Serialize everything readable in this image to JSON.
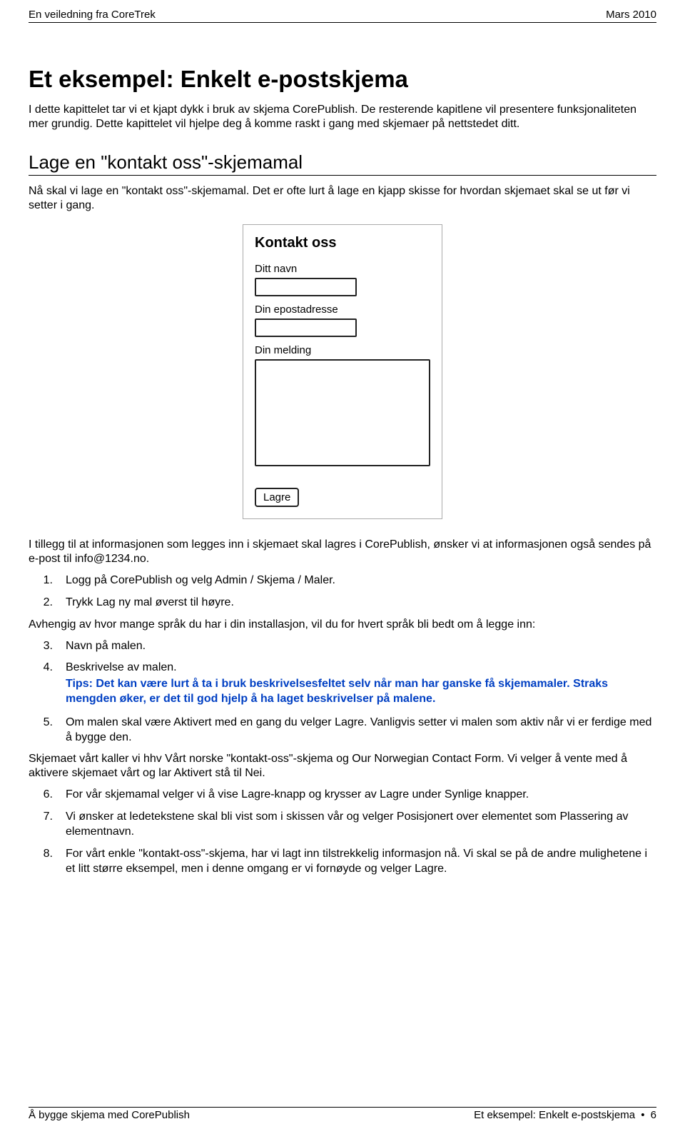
{
  "header": {
    "left": "En veiledning fra CoreTrek",
    "right": "Mars 2010"
  },
  "h1": "Et eksempel: Enkelt e-postskjema",
  "intro": "I dette kapittelet tar vi et kjapt dykk i bruk av skjema CorePublish. De resterende kapitlene vil presentere funksjonaliteten mer grundig. Dette kapittelet vil hjelpe deg å komme raskt i gang med skjemaer på nettstedet ditt.",
  "h2": "Lage en \"kontakt oss\"-skjemamal",
  "p_after_h2": "Nå skal vi lage en \"kontakt oss\"-skjemamal. Det er ofte lurt å lage en kjapp skisse for hvordan skjemaet skal se ut før vi setter i gang.",
  "sketch": {
    "title": "Kontakt oss",
    "label_name": "Ditt navn",
    "label_email": "Din epostadresse",
    "label_message": "Din melding",
    "button": "Lagre"
  },
  "p_after_sketch": "I tillegg til at informasjonen som legges inn i skjemaet skal lagres i CorePublish, ønsker vi at informasjonen også sendes på e-post til info@1234.no.",
  "steps1": [
    {
      "n": "1.",
      "text": "Logg på CorePublish og velg Admin / Skjema / Maler."
    },
    {
      "n": "2.",
      "text": "Trykk Lag ny mal øverst til høyre."
    }
  ],
  "p_mid": "Avhengig av hvor mange språk du har i din installasjon, vil du for hvert språk bli bedt om å legge inn:",
  "steps2": [
    {
      "n": "3.",
      "text": "Navn på malen."
    },
    {
      "n": "4.",
      "text": "Beskrivelse av malen.",
      "tip": "Tips: Det kan være lurt å ta i bruk beskrivelsesfeltet selv når man har ganske få skjemamaler. Straks mengden øker, er det til god hjelp å ha laget beskrivelser på malene."
    },
    {
      "n": "5.",
      "text": "Om malen skal være Aktivert med en gang du velger Lagre. Vanligvis setter vi malen som aktiv når vi er ferdige med å bygge den."
    }
  ],
  "p_mid2": "Skjemaet vårt kaller vi hhv Vårt norske \"kontakt-oss\"-skjema og Our Norwegian Contact Form. Vi velger å vente med å aktivere skjemaet vårt og lar Aktivert stå til Nei.",
  "steps3": [
    {
      "n": "6.",
      "text": "For vår skjemamal velger vi å vise Lagre-knapp og krysser av Lagre under Synlige knapper."
    },
    {
      "n": "7.",
      "text": "Vi ønsker at ledetekstene skal bli vist som i skissen vår og velger Posisjonert over elementet som Plassering av elementnavn."
    },
    {
      "n": "8.",
      "text": "For vårt enkle \"kontakt-oss\"-skjema, har vi lagt inn tilstrekkelig informasjon nå. Vi skal se på de andre mulighetene i et litt større eksempel, men i denne omgang er vi fornøyde og velger Lagre."
    }
  ],
  "footer": {
    "left": "Å bygge skjema med CorePublish",
    "right_text": "Et eksempel: Enkelt e-postskjema",
    "right_bullet": "•",
    "right_page": "6"
  }
}
